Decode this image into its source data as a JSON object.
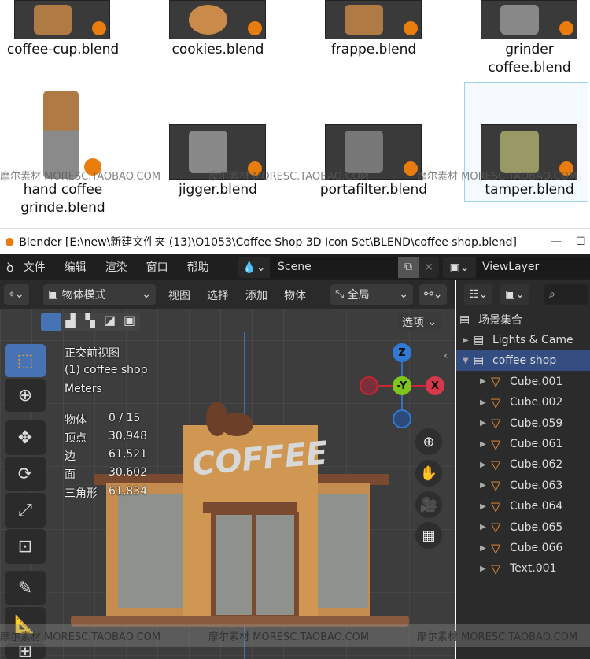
{
  "file_browser": {
    "items": [
      {
        "label": "coffee-cup.blend"
      },
      {
        "label": "cookies.blend"
      },
      {
        "label": "frappe.blend"
      },
      {
        "label": "grinder coffee.blend"
      },
      {
        "label": "hand coffee grinde.blend"
      },
      {
        "label": "jigger.blend"
      },
      {
        "label": "portafilter.blend"
      },
      {
        "label": "tamper.blend",
        "selected": true
      }
    ]
  },
  "watermark": "摩尔素材  MORESC.TAOBAO.COM",
  "window": {
    "title": "Blender [E:\\new\\新建文件夹 (13)\\O1053\\Coffee Shop 3D Icon Set\\BLEND\\coffee shop.blend]",
    "minimize": "—",
    "maximize": "☐"
  },
  "menu": {
    "items": [
      "文件",
      "编辑",
      "渲染",
      "窗口",
      "帮助"
    ],
    "scene": "Scene",
    "view_layer": "ViewLayer"
  },
  "viewport_header": {
    "mode": "物体模式",
    "menus": [
      "视图",
      "选择",
      "添加",
      "物体"
    ],
    "orientation": "全局",
    "options": "选项"
  },
  "overlay": {
    "view": "正交前视图",
    "collection": "(1) coffee shop",
    "units": "Meters",
    "stats": [
      {
        "label": "物体",
        "value": "0 / 15"
      },
      {
        "label": "顶点",
        "value": "30,948"
      },
      {
        "label": "边",
        "value": "61,521"
      },
      {
        "label": "面",
        "value": "30,602"
      },
      {
        "label": "三角形",
        "value": "61,834"
      }
    ]
  },
  "gizmo": {
    "z": "Z",
    "y": "-Y",
    "x": "X"
  },
  "scene_text": "COFFEE",
  "outliner": {
    "root": "场景集合",
    "items": [
      {
        "label": "Lights & Came",
        "level": 0,
        "type": "collection"
      },
      {
        "label": "coffee shop",
        "level": 0,
        "type": "collection",
        "selected": true
      },
      {
        "label": "Cube.001",
        "level": 1
      },
      {
        "label": "Cube.002",
        "level": 1
      },
      {
        "label": "Cube.059",
        "level": 1
      },
      {
        "label": "Cube.061",
        "level": 1
      },
      {
        "label": "Cube.062",
        "level": 1
      },
      {
        "label": "Cube.063",
        "level": 1
      },
      {
        "label": "Cube.064",
        "level": 1
      },
      {
        "label": "Cube.065",
        "level": 1
      },
      {
        "label": "Cube.066",
        "level": 1
      },
      {
        "label": "Text.001",
        "level": 1
      }
    ]
  },
  "colors": {
    "accent": "#4772b3",
    "orange": "#f0913a",
    "x": "#d5384a",
    "y": "#7ec61b",
    "z": "#2f7ad4"
  }
}
